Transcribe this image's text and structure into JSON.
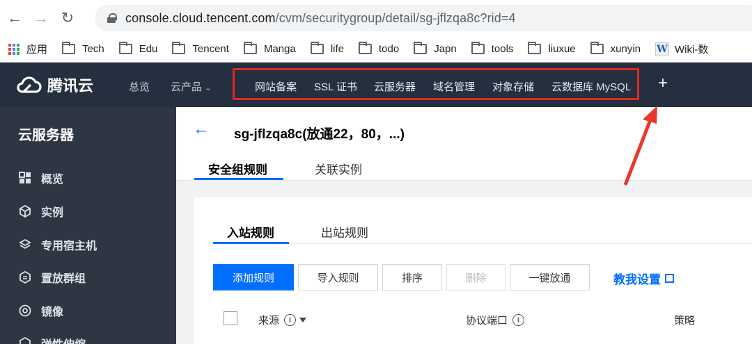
{
  "browser": {
    "url_host": "console.cloud.tencent.com",
    "url_path": "/cvm/securitygroup/detail/sg-jflzqa8c?rid=4",
    "bookmarks": [
      "应用",
      "Tech",
      "Edu",
      "Tencent",
      "Manga",
      "life",
      "todo",
      "Japn",
      "tools",
      "liuxue",
      "xunyin",
      "Wiki-数"
    ]
  },
  "topnav": {
    "brand": "腾讯云",
    "overview": "总览",
    "products": "云产品",
    "pinned": [
      "网站备案",
      "SSL 证书",
      "云服务器",
      "域名管理",
      "对象存储",
      "云数据库 MySQL"
    ],
    "add": "+"
  },
  "sidebar": {
    "title": "云服务器",
    "items": [
      {
        "label": "概览",
        "icon": "grid-icon"
      },
      {
        "label": "实例",
        "icon": "cube-icon"
      },
      {
        "label": "专用宿主机",
        "icon": "layers-icon"
      },
      {
        "label": "置放群组",
        "icon": "hexagon-icon"
      },
      {
        "label": "镜像",
        "icon": "disc-icon"
      },
      {
        "label": "弹性伸缩",
        "icon": "scale-icon"
      }
    ]
  },
  "main": {
    "title": "sg-jflzqa8c(放通22，80，...)",
    "tabs": [
      "安全组规则",
      "关联实例"
    ],
    "subtabs": [
      "入站规则",
      "出站规则"
    ],
    "buttons": [
      "添加规则",
      "导入规则",
      "排序",
      "删除",
      "一键放通"
    ],
    "help_link": "教我设置",
    "columns": [
      "来源",
      "协议端口",
      "策略"
    ]
  },
  "colors": {
    "accent": "#006eff",
    "nav_bg": "#242f3f",
    "sidebar_bg": "#2d3642",
    "highlight": "#e02a1f"
  }
}
